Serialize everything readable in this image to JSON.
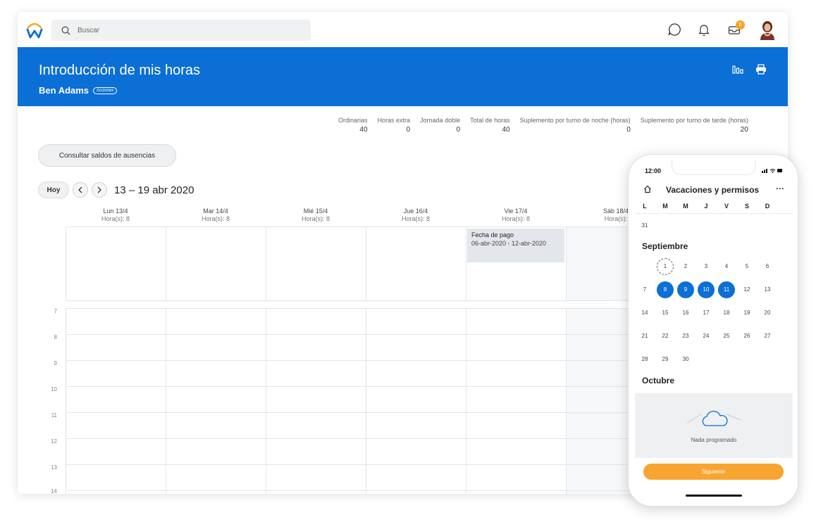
{
  "topbar": {
    "search_placeholder": "Buscar",
    "inbox_badge": "9"
  },
  "header": {
    "title": "Introducción de mis horas",
    "user": "Ben Adams",
    "actions": "Acciones"
  },
  "summary": [
    {
      "label": "Ordinarias",
      "value": "40"
    },
    {
      "label": "Horas extra",
      "value": "0"
    },
    {
      "label": "Jornada doble",
      "value": "0"
    },
    {
      "label": "Total de horas",
      "value": "40"
    },
    {
      "label": "Suplemento por turno de noche (horas)",
      "value": "0"
    },
    {
      "label": "Suplemento por turno de tarde (horas)",
      "value": "20"
    }
  ],
  "balances_button": "Consultar saldos de ausencias",
  "nav": {
    "today": "Hoy",
    "range": "13 – 19 abr 2020"
  },
  "days": [
    {
      "day": "Lun 13/4",
      "hours": "Hora(s): 8"
    },
    {
      "day": "Mar 14/4",
      "hours": "Hora(s): 8"
    },
    {
      "day": "Mié 15/4",
      "hours": "Hora(s): 8"
    },
    {
      "day": "Jue 16/4",
      "hours": "Hora(s): 8"
    },
    {
      "day": "Vie 17/4",
      "hours": "Hora(s): 8"
    },
    {
      "day": "Sáb 18/4",
      "hours": "Hora(s):"
    }
  ],
  "payday": {
    "title": "Fecha de pago",
    "range": "06-abr-2020 - 12-abr-2020"
  },
  "hours": [
    "7",
    "8",
    "9",
    "10",
    "11",
    "12",
    "13",
    "14"
  ],
  "phone": {
    "time": "12:00",
    "title": "Vacaciones y permisos",
    "more": "···",
    "weekdays": [
      "L",
      "M",
      "M",
      "J",
      "V",
      "S",
      "D"
    ],
    "prev_day": "31",
    "month1": "Septiembre",
    "month2": "Octubre",
    "weeks": [
      [
        "1",
        "2",
        "3",
        "4",
        "5",
        "6"
      ],
      [
        "7",
        "8",
        "9",
        "10",
        "11",
        "12",
        "13"
      ],
      [
        "14",
        "15",
        "16",
        "17",
        "18",
        "19",
        "20"
      ],
      [
        "21",
        "22",
        "23",
        "24",
        "25",
        "26",
        "27"
      ],
      [
        "28",
        "29",
        "30"
      ]
    ],
    "empty_msg": "Nada programado",
    "next_button": "Siguiente"
  }
}
